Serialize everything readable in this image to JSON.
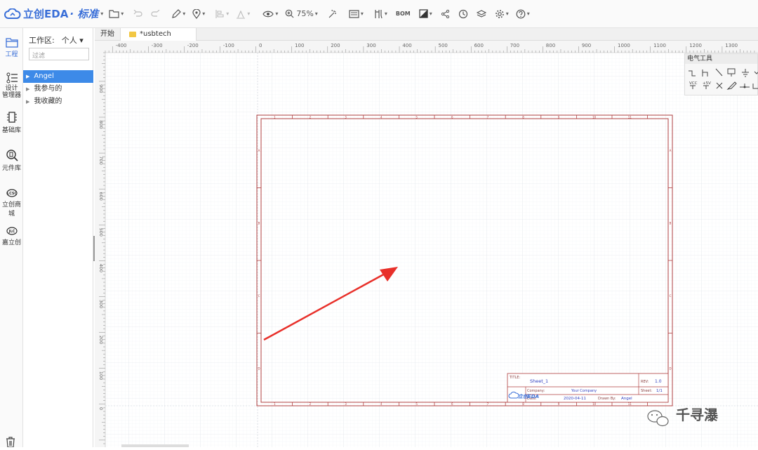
{
  "toolbar": {
    "logo_text": "立创EDA",
    "edition": "· 标准",
    "zoom": "75%",
    "bom_label": "BOM"
  },
  "iconbar": {
    "items": [
      {
        "label": "工程",
        "icon": "project-icon"
      },
      {
        "label": "设计",
        "label2": "管理器",
        "icon": "design-manager-icon"
      },
      {
        "label": "基础库",
        "icon": "basic-library-icon"
      },
      {
        "label": "元件库",
        "icon": "component-library-icon"
      },
      {
        "label": "立创商城",
        "icon": "lcsc-mall-icon"
      },
      {
        "label": "嘉立创",
        "icon": "jlc-icon"
      }
    ]
  },
  "panel": {
    "workspace_label": "工作区:",
    "workspace_value": "个人 ▾",
    "filter_placeholder": "过滤",
    "tree": [
      "Angel",
      "我参与的",
      "我收藏的"
    ]
  },
  "tabs": [
    "开始",
    "*usbtech"
  ],
  "ruler_h": [
    "-400",
    "-300",
    "-200",
    "-100",
    "0",
    "100",
    "200",
    "300",
    "400",
    "500",
    "600",
    "700",
    "800",
    "900",
    "1000",
    "1100",
    "1200",
    "1300"
  ],
  "ruler_v": [
    "900",
    "800",
    "700",
    "600",
    "500",
    "400",
    "300",
    "200",
    "100",
    "0"
  ],
  "palette": {
    "title": "电气工具",
    "vcc": "VCC",
    "p5v": "+5V"
  },
  "title_block": {
    "title_label": "TITLE:",
    "title_value": "Sheet_1",
    "rev_label": "REV:",
    "rev_value": "1.0",
    "company_label": "Company:",
    "company_value": "Your Company",
    "sheet_label": "Sheet:",
    "sheet_value": "1/1",
    "date_label": "Date:",
    "date_value": "2020-04-11",
    "drawn_label": "Drawn By:",
    "drawn_value": "Angel",
    "logo": "立创EDA"
  },
  "border_cols": [
    "1",
    "2",
    "3",
    "4",
    "5",
    "6",
    "7",
    "8",
    "9",
    "10",
    "11"
  ],
  "border_rows": [
    "A",
    "B",
    "C",
    "D"
  ],
  "watermark": "千寻瀑"
}
